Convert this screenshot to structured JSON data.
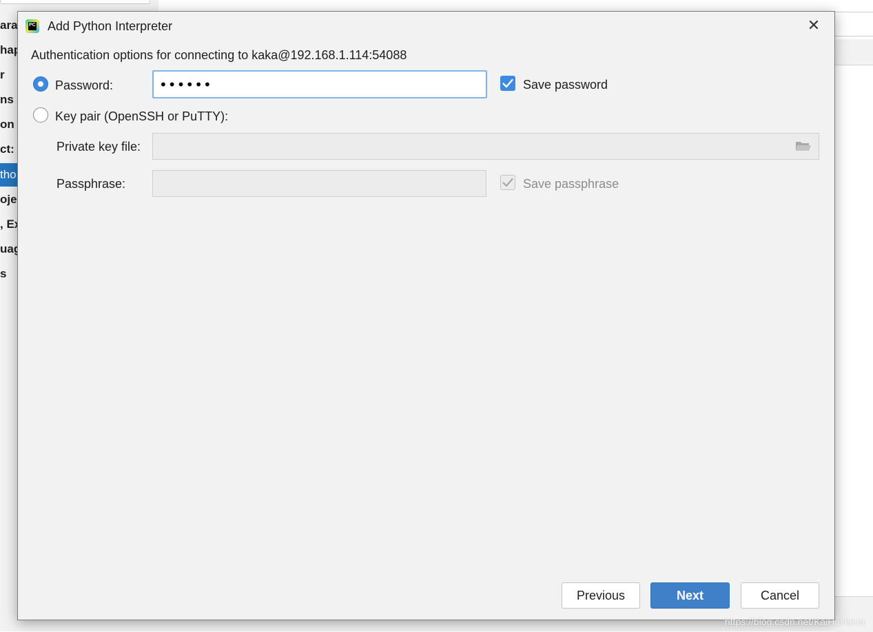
{
  "background": {
    "sidebar_items": [
      {
        "label": "aran",
        "selected": false
      },
      {
        "label": "hap",
        "selected": false
      },
      {
        "label": "r",
        "selected": false
      },
      {
        "label": "ns",
        "selected": false
      },
      {
        "label": "on",
        "selected": false
      },
      {
        "label": "ct:",
        "selected": false
      },
      {
        "label": "tho",
        "selected": true
      },
      {
        "label": "ojec",
        "selected": false
      },
      {
        "label": ", Ex",
        "selected": false
      },
      {
        "label": "uag",
        "selected": false
      },
      {
        "label": "s",
        "selected": false
      }
    ],
    "watermark": "https://blog.csdn.net/KaiHaHaHa"
  },
  "dialog": {
    "title": "Add Python Interpreter",
    "app_icon": "pycharm-icon",
    "app_icon_text": "PC",
    "close_glyph": "✕",
    "heading": "Authentication options for connecting to kaka@192.168.1.114:54088",
    "auth": {
      "password_option": {
        "label": "Password:",
        "selected": true
      },
      "password_value": "••••••",
      "save_password": {
        "label": "Save password",
        "checked": true
      },
      "keypair_option": {
        "label": "Key pair (OpenSSH or PuTTY):",
        "selected": false
      },
      "private_key_label": "Private key file:",
      "private_key_value": "",
      "passphrase_label": "Passphrase:",
      "passphrase_value": "",
      "save_passphrase": {
        "label": "Save passphrase",
        "checked": true,
        "enabled": false
      }
    },
    "buttons": {
      "previous": "Previous",
      "next": "Next",
      "cancel": "Cancel"
    }
  },
  "colors": {
    "accent": "#3d8ae0",
    "primary_button": "#3f80c8",
    "dialog_bg": "#f2f2f2",
    "selection": "#2675bf"
  }
}
